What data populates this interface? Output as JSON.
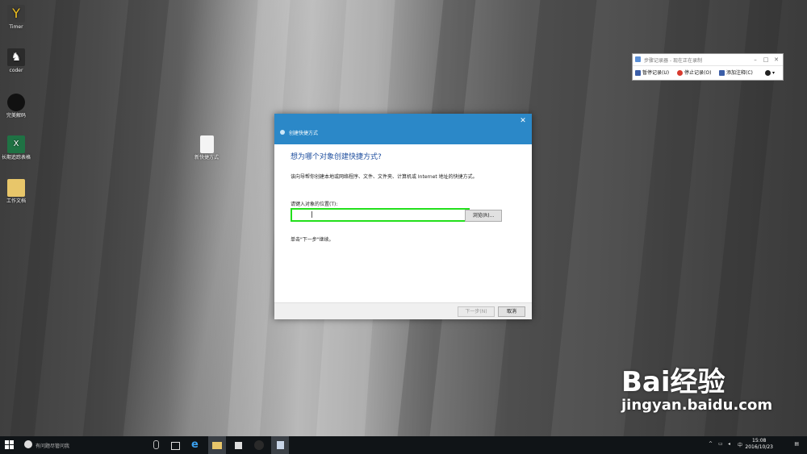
{
  "desktop": {
    "icons": [
      {
        "label": "Timer"
      },
      {
        "label": "coder"
      },
      {
        "label": "完美解码"
      },
      {
        "label": "长期追踪表格"
      },
      {
        "label": "工作文档"
      },
      {
        "label": "新快捷方式"
      }
    ]
  },
  "dialog": {
    "title": "创建快捷方式",
    "heading": "想为哪个对象创建快捷方式?",
    "description": "该向导帮你创建本地或网络程序、文件、文件夹、计算机或 Internet 地址的快捷方式。",
    "location_label": "请键入对象的位置(T):",
    "location_value": "",
    "browse_label": "浏览(R)...",
    "hint": "单击\"下一步\"继续。",
    "next_label": "下一步(N)",
    "cancel_label": "取消"
  },
  "recorder": {
    "title": "步骤记录器 - 现在正在录制",
    "pause_label": "暂停记录(U)",
    "stop_label": "停止记录(O)",
    "comment_label": "添加注释(C)"
  },
  "taskbar": {
    "search_placeholder": "有问题尽管问我",
    "ime": "中",
    "time": "15:08",
    "date": "2016/10/23"
  },
  "watermark": {
    "brand": "Bai经验",
    "url": "jingyan.baidu.com"
  },
  "colors": {
    "dialog_titlebar": "#2b88c8",
    "heading": "#1e4e9e",
    "highlight_border": "#22e01b",
    "taskbar": "#101417"
  }
}
